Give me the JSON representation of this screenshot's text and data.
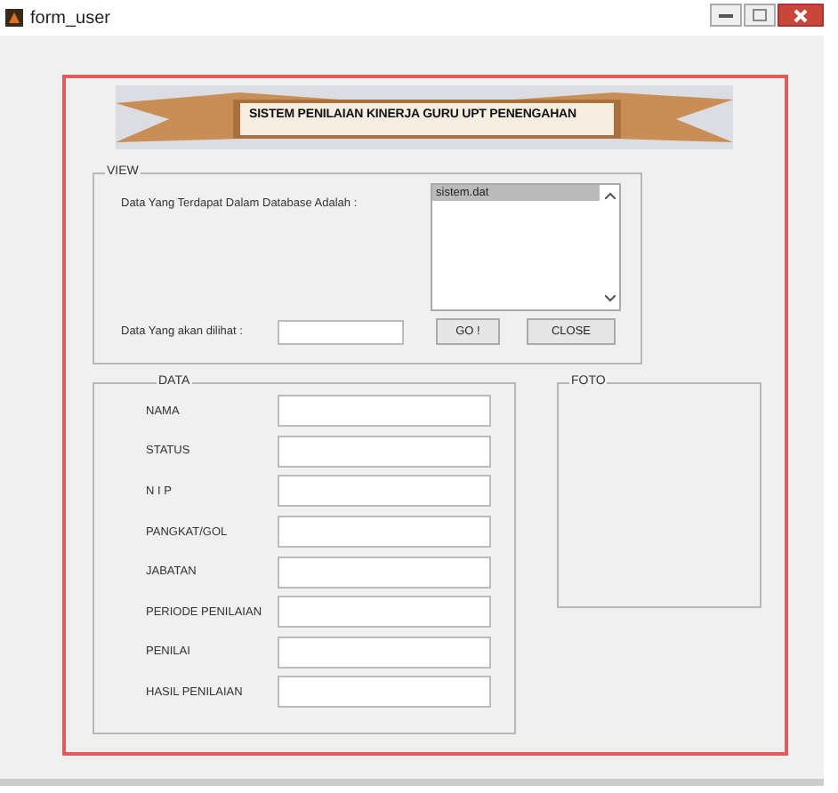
{
  "window": {
    "title": "form_user"
  },
  "banner": {
    "title": "SISTEM PENILAIAN KINERJA GURU UPT PENENGAHAN"
  },
  "view": {
    "legend": "VIEW",
    "list_label": "Data Yang Terdapat Dalam Database Adalah :",
    "list": [
      {
        "label": "sistem.dat",
        "selected": true
      }
    ],
    "input_label": "Data Yang akan dilihat :",
    "buttons": [
      "GO !",
      "CLOSE"
    ]
  },
  "data": {
    "legend": "DATA",
    "fields": [
      {
        "label": "NAMA"
      },
      {
        "label": "STATUS"
      },
      {
        "label": "N I P"
      },
      {
        "label": "PANGKAT/GOL"
      },
      {
        "label": "JABATAN"
      },
      {
        "label": "PERIODE PENILAIAN"
      },
      {
        "label": "PENILAI"
      },
      {
        "label": "HASIL PENILAIAN"
      }
    ]
  },
  "foto": {
    "legend": "FOTO"
  }
}
